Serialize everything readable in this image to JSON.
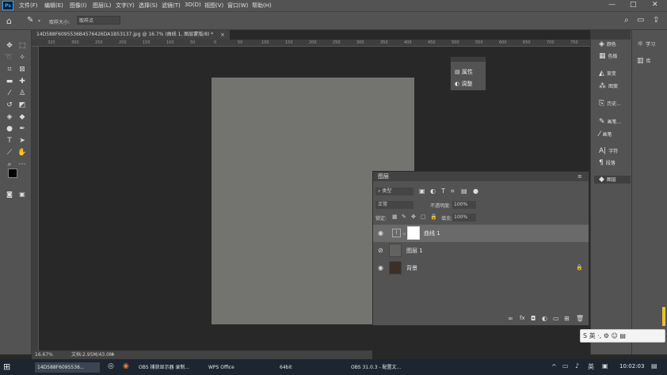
{
  "app": {
    "logo": "Ps",
    "menu": [
      "文件(F)",
      "编辑(E)",
      "图像(I)",
      "图层(L)",
      "文字(Y)",
      "选择(S)",
      "滤镜(T)",
      "3D(D)",
      "视图(V)",
      "窗口(W)",
      "帮助(H)"
    ],
    "window_controls": [
      "—",
      "□",
      "✕"
    ]
  },
  "options_bar": {
    "sample_size_label": "取样大小:",
    "sample_size_value": "取样点"
  },
  "document": {
    "tab_title": "14D588F6095536B4576426DA1B53137.jpg @ 16.7% (曲线 1, 图层蒙版/8) *",
    "close": "×",
    "ruler_marks": [
      "320",
      "300",
      "250",
      "200",
      "150",
      "100",
      "50",
      "0",
      "50",
      "100",
      "150",
      "200",
      "250",
      "300",
      "350",
      "400",
      "450",
      "500",
      "550",
      "600",
      "650",
      "700",
      "750"
    ]
  },
  "status_bar": {
    "zoom": "16.67%",
    "doc_info": "文档:2.95M/43.0M",
    "arrow": ">"
  },
  "float_panel": {
    "items": [
      "属性",
      "调整"
    ]
  },
  "layers_panel": {
    "title": "图层",
    "kind_label": "类型",
    "blend_mode": "正常",
    "opacity_label": "不透明度:",
    "opacity_value": "100%",
    "lock_label": "锁定:",
    "fill_label": "填充:",
    "fill_value": "100%",
    "layers": [
      {
        "name": "曲线 1",
        "selected": true
      },
      {
        "name": "图层 1",
        "selected": false
      },
      {
        "name": "背景",
        "selected": false
      }
    ],
    "footer_icons": [
      "link-icon",
      "fx-icon",
      "mask-icon",
      "adjustment-icon",
      "group-icon",
      "new-layer-icon",
      "trash-icon"
    ]
  },
  "right_dock": {
    "col1": [
      {
        "icon": "color-icon",
        "label": "颜色"
      },
      {
        "icon": "swatches-icon",
        "label": "色板"
      },
      {
        "icon": "gradient-icon",
        "label": "渐变"
      },
      {
        "icon": "pattern-icon",
        "label": "图案"
      },
      {
        "icon": "history-icon",
        "label": "历史..."
      },
      {
        "icon": "brush-settings-icon",
        "label": "画笔..."
      },
      {
        "icon": "brush-icon",
        "label": "画笔"
      },
      {
        "icon": "character-icon",
        "label": "字符"
      },
      {
        "icon": "paragraph-icon",
        "label": "段落"
      },
      {
        "icon": "layers-icon",
        "label": "图层"
      }
    ],
    "col2": [
      {
        "icon": "learn-icon",
        "label": "学习"
      },
      {
        "icon": "library-icon",
        "label": "库"
      }
    ]
  },
  "taskbar": {
    "items": [
      "14D588F6095536...",
      "OBS 捕获显示器 录制...",
      "WPS Office",
      "64bit",
      "OBS 31.0.3 - 配置文..."
    ],
    "clock": "10:02:03"
  },
  "ime": {
    "label": "S 英 ·, ⚙ ☺ ▤"
  }
}
